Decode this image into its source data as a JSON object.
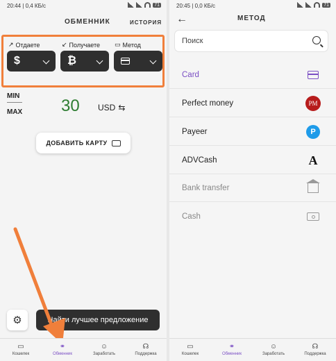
{
  "left": {
    "status": {
      "time": "20:44",
      "net": "0,4 КБ/с",
      "battery": "71"
    },
    "title": "ОБМЕННИК",
    "history": "ИСТОРИЯ",
    "give_label": "Отдаете",
    "receive_label": "Получаете",
    "method_label": "Метод",
    "give_symbol": "$",
    "receive_symbol": "₿",
    "min_label": "MIN",
    "max_label": "MAX",
    "amount": "30",
    "currency": "USD",
    "add_card": "ДОБАВИТЬ КАРТУ",
    "find_offer": "Найти лучшее предложение"
  },
  "right": {
    "status": {
      "time": "20:45",
      "net": "0,0 КБ/с",
      "battery": "71"
    },
    "title": "МЕТОД",
    "search_placeholder": "Поиск",
    "methods": [
      {
        "name": "Card",
        "icon": "card-icon"
      },
      {
        "name": "Perfect money",
        "icon": "perfect-money-logo",
        "badge": "PM"
      },
      {
        "name": "Payeer",
        "icon": "payeer-logo",
        "badge": "P"
      },
      {
        "name": "ADVCash",
        "icon": "advcash-logo",
        "badge": "A"
      },
      {
        "name": "Bank transfer",
        "icon": "bank-icon"
      },
      {
        "name": "Cash",
        "icon": "cash-icon"
      }
    ]
  },
  "nav": {
    "wallet": "Кошелек",
    "exchanger": "Обменник",
    "earn": "Заработать",
    "support": "Поддержка"
  },
  "colors": {
    "accent": "#7b4fc4",
    "highlight": "#f07f3b",
    "amount": "#2e7d32",
    "dark_button": "#2f2f2f"
  }
}
